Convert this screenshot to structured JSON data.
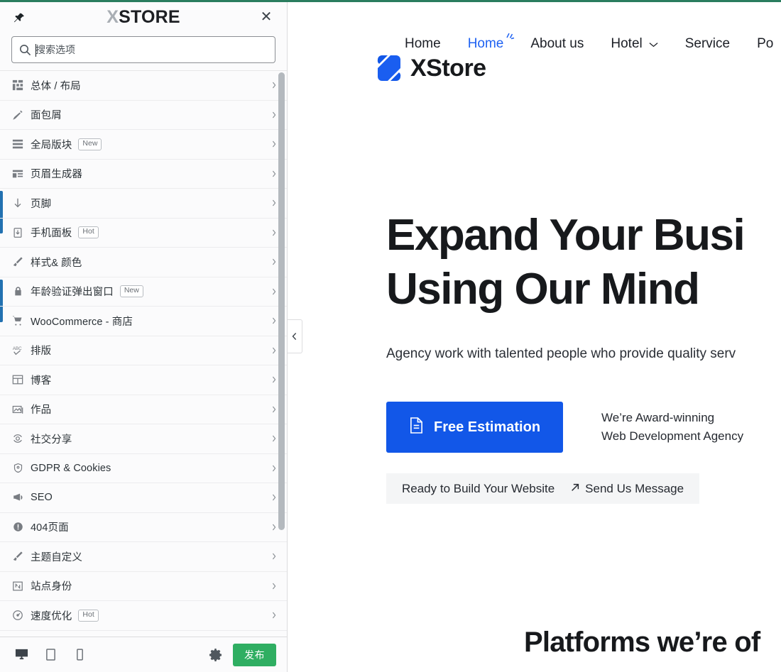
{
  "theme": {
    "accent_blue": "#2271b1",
    "publish_green": "#2fae62",
    "site_blue": "#1257e8",
    "top_strip_green": "#2a7d5f"
  },
  "customizer": {
    "pin_icon": "pin-icon",
    "logo_x": "X",
    "logo_rest": "STORE",
    "close_label": "✕",
    "search": {
      "placeholder": "搜索选项",
      "value": "",
      "icon": "search-icon"
    },
    "menu_items": [
      {
        "label": "总体 / 布局",
        "icon": "layout-grid-icon",
        "badge": ""
      },
      {
        "label": "面包屑",
        "icon": "carrot-icon",
        "badge": ""
      },
      {
        "label": "全局版块",
        "icon": "blocks-icon",
        "badge": "New"
      },
      {
        "label": "页眉生成器",
        "icon": "header-builder-icon",
        "badge": ""
      },
      {
        "label": "页脚",
        "icon": "arrow-down-icon",
        "badge": ""
      },
      {
        "label": "手机面板",
        "icon": "mobile-panel-icon",
        "badge": "Hot"
      },
      {
        "label": "样式& 颜色",
        "icon": "paintbrush-icon",
        "badge": ""
      },
      {
        "label": "年龄验证弹出窗口",
        "icon": "lock-icon",
        "badge": "New"
      },
      {
        "label": "WooCommerce - 商店",
        "icon": "cart-icon",
        "badge": ""
      },
      {
        "label": "排版",
        "icon": "typography-icon",
        "badge": ""
      },
      {
        "label": "博客",
        "icon": "table-icon",
        "badge": ""
      },
      {
        "label": "作品",
        "icon": "gallery-icon",
        "badge": ""
      },
      {
        "label": "社交分享",
        "icon": "share-icon",
        "badge": ""
      },
      {
        "label": "GDPR & Cookies",
        "icon": "shield-icon",
        "badge": ""
      },
      {
        "label": "SEO",
        "icon": "megaphone-icon",
        "badge": ""
      },
      {
        "label": "404页面",
        "icon": "warning-icon",
        "badge": ""
      },
      {
        "label": "主题自定义",
        "icon": "paintbrush-icon",
        "badge": ""
      },
      {
        "label": "站点身份",
        "icon": "site-identity-icon",
        "badge": ""
      },
      {
        "label": "速度优化",
        "icon": "speed-icon",
        "badge": "Hot"
      }
    ],
    "footer": {
      "device_desktop": "desktop-icon",
      "device_tablet": "tablet-icon",
      "device_mobile": "mobile-icon",
      "gear": "gear-icon",
      "publish_label": "发布"
    },
    "collapse_toggle_icon": "chevron-left-icon"
  },
  "preview": {
    "nav": [
      {
        "label": "Home",
        "active": false,
        "caret": false,
        "spark": false
      },
      {
        "label": "Home",
        "active": true,
        "caret": false,
        "spark": true
      },
      {
        "label": "About us",
        "active": false,
        "caret": false,
        "spark": false
      },
      {
        "label": "Hotel",
        "active": false,
        "caret": true,
        "spark": false
      },
      {
        "label": "Service",
        "active": false,
        "caret": false,
        "spark": false
      },
      {
        "label": "Po",
        "active": false,
        "caret": false,
        "spark": false
      }
    ],
    "logo_text": "XStore",
    "hero": {
      "title_line1": "Expand Your Busi",
      "title_line2": "Using Our Mind",
      "subtitle": "Agency work with talented people who provide quality serv"
    },
    "cta": {
      "primary_label": "Free Estimation",
      "primary_icon": "document-icon",
      "award_line1": "We’re Award-winning",
      "award_line2": "Web Development Agency"
    },
    "ready_bar": {
      "text": "Ready to Build Your Website",
      "link_label": "Send Us Message",
      "link_icon": "arrow-up-right-icon"
    },
    "platforms_title": "Platforms we’re of"
  }
}
